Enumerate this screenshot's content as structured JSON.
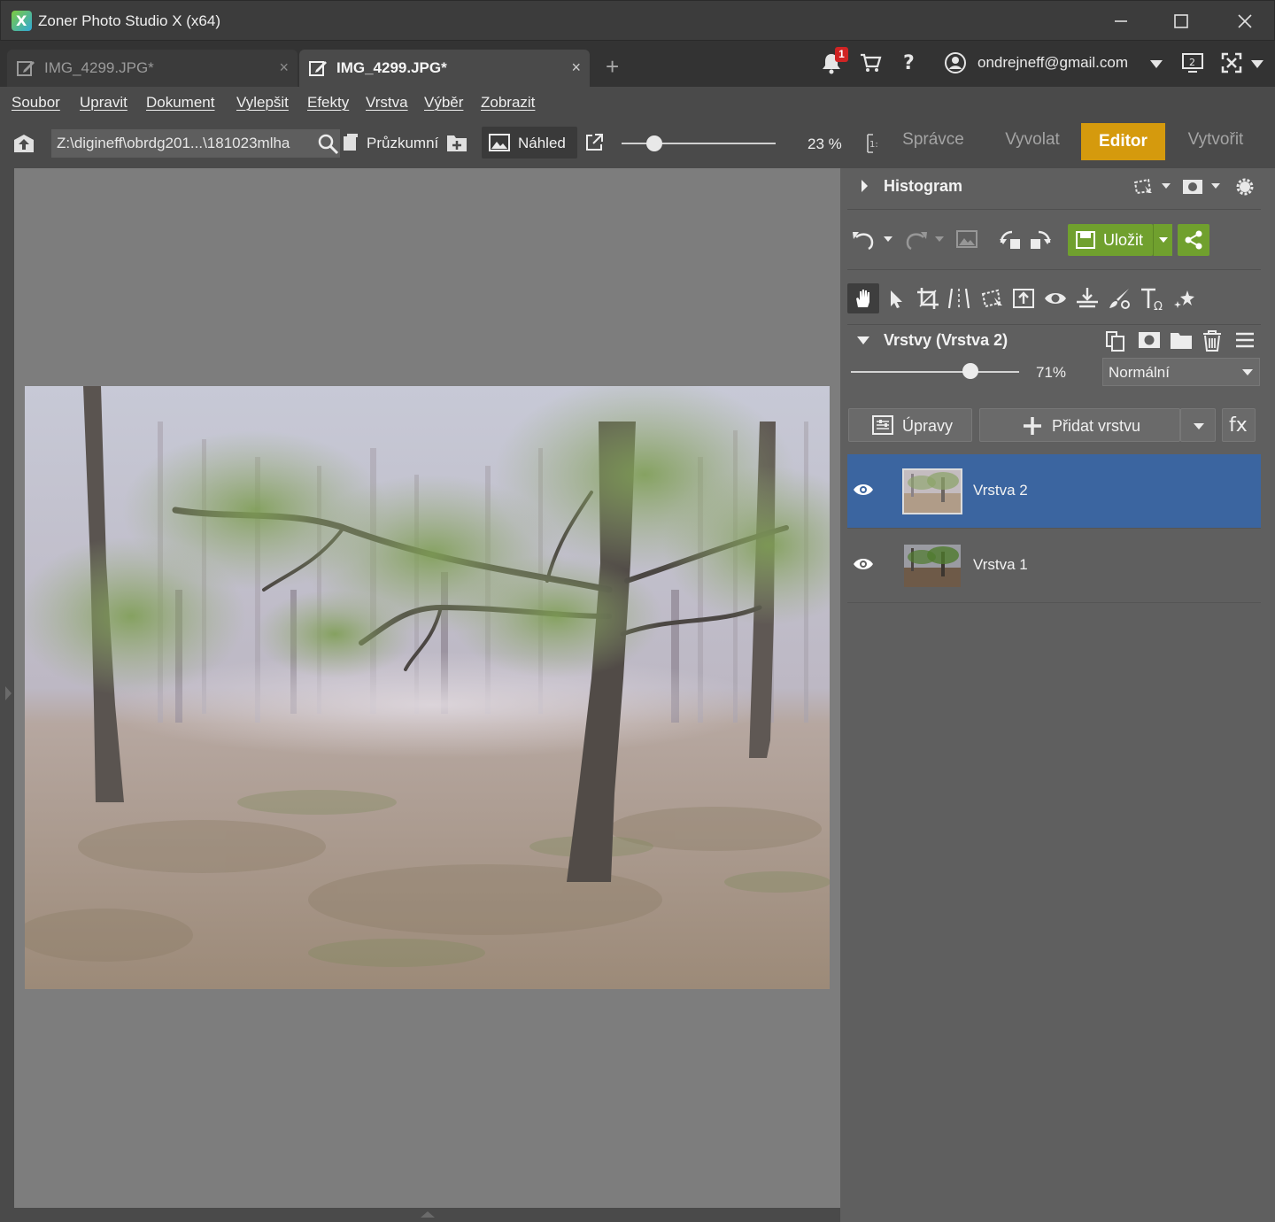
{
  "window": {
    "title": "Zoner Photo Studio X (x64)",
    "controls": [
      "minimize-icon",
      "maximize-icon",
      "close-icon"
    ]
  },
  "tabs": [
    {
      "label": "IMG_4299.JPG*",
      "active": false,
      "icon": "edit-icon",
      "close": "×"
    },
    {
      "label": "IMG_4299.JPG*",
      "active": true,
      "icon": "edit-icon",
      "close": "×"
    }
  ],
  "tabbar": {
    "new_tab": "+",
    "notifications_count": "1",
    "user_email": "ondrejneff@gmail.com",
    "icons": [
      "bell-icon",
      "cart-icon",
      "help-icon",
      "user-icon",
      "monitor-icon",
      "fullscreen-icon"
    ],
    "monitor_label": "2"
  },
  "menu": [
    "Soubor",
    "Upravit",
    "Dokument",
    "Vylepšit",
    "Efekty",
    "Vrstva",
    "Výběr",
    "Zobrazit"
  ],
  "toolbar": {
    "path": "Z:\\digineff\\obrdg201...\\181023mlha",
    "explorer_label": "Průzkumní",
    "preview_label": "Náhled",
    "zoom_value": "23 %",
    "zoom_fraction": 0.23,
    "ratio_label": "1:"
  },
  "modes": [
    {
      "label": "Správce",
      "active": false
    },
    {
      "label": "Vyvolat",
      "active": false
    },
    {
      "label": "Editor",
      "active": true
    },
    {
      "label": "Vytvořit",
      "active": false
    }
  ],
  "panel": {
    "histogram_title": "Histogram",
    "save_label": "Uložit",
    "layers_title": "Vrstvy (Vrstva 2)",
    "opacity_value": "71%",
    "opacity_fraction": 0.71,
    "blend_mode": "Normální",
    "adjustments_label": "Úpravy",
    "add_layer_label": "Přidat vrstvu",
    "fx_label": "fx",
    "tools": [
      "hand-icon",
      "pointer-icon",
      "crop-icon",
      "straighten-icon",
      "transform-icon",
      "export-icon",
      "red-eye-icon",
      "level-icon",
      "brush-icon",
      "text-icon",
      "effects-icon"
    ],
    "layers": [
      {
        "name": "Vrstva 2",
        "selected": true,
        "visible": true
      },
      {
        "name": "Vrstva 1",
        "selected": false,
        "visible": true
      }
    ]
  },
  "colors": {
    "accent_editor": "#d59a0d",
    "save_green": "#70a02e",
    "selection_blue": "#3b65a0",
    "badge_red": "#d02424"
  }
}
